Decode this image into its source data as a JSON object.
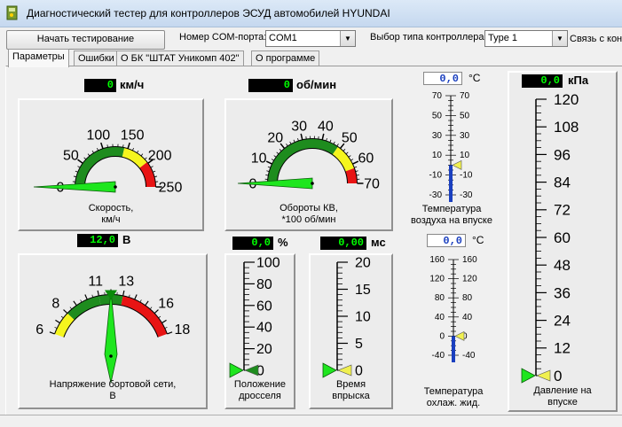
{
  "window": {
    "title": "Диагностический тестер для контроллеров ЭСУД автомобилей HYUNDAI"
  },
  "toolbar": {
    "start_label": "Начать тестирование",
    "com_label": "Номер COM-порта:",
    "com_value": "COM1",
    "ctrl_label": "Выбор типа контроллера",
    "ctrl_value": "Type 1",
    "link_label": "Связь с кон"
  },
  "tabs": [
    {
      "label": "Параметры",
      "active": true
    },
    {
      "label": "Ошибки",
      "active": false
    },
    {
      "label": "О БК \"ШТАТ Уникомп 402\"",
      "active": false
    },
    {
      "label": "О программе",
      "active": false
    }
  ],
  "colors": {
    "green": "#1e8c1e",
    "yellow": "#f5f51e",
    "red": "#e81414",
    "needle": "#1ee61e",
    "blue_bar": "#1a3fbf"
  },
  "gauges": {
    "speed": {
      "display": "0",
      "unit": "км/ч",
      "caption1": "Скорость,",
      "caption2": "км/ч",
      "value": 0,
      "ticks": [
        "0",
        "50",
        "100",
        "150",
        "200",
        "250"
      ]
    },
    "rpm": {
      "display": "0",
      "unit": "об/мин",
      "caption1": "Обороты КВ,",
      "caption2": "*100 об/мин",
      "value": 0,
      "ticks": [
        "0",
        "10",
        "20",
        "30",
        "40",
        "50",
        "60",
        "70"
      ]
    },
    "voltage": {
      "display": "12,0",
      "unit": "В",
      "caption1": "Напряжение бортовой сети,",
      "caption2": "В",
      "value": 12.0,
      "ticks": [
        "6",
        "8",
        "11",
        "13",
        "16",
        "18"
      ]
    }
  },
  "bars": {
    "throttle": {
      "display": "0,0",
      "unit": "%",
      "caption1": "Положение",
      "caption2": "дросселя",
      "value": 0,
      "ticks": [
        "100",
        "80",
        "60",
        "40",
        "20",
        "0"
      ]
    },
    "injection": {
      "display": "0,00",
      "unit": "мс",
      "caption1": "Время",
      "caption2": "впрыска",
      "value": 0,
      "ticks": [
        "20",
        "15",
        "10",
        "5",
        "0"
      ]
    },
    "pressure": {
      "display": "0,0",
      "unit": "кПа",
      "caption1": "Давление на",
      "caption2": "впуске",
      "value": 0,
      "ticks": [
        "120",
        "108",
        "96",
        "84",
        "72",
        "60",
        "48",
        "36",
        "24",
        "12",
        "0"
      ]
    }
  },
  "thermo": {
    "air": {
      "display": "0,0",
      "unit": "°C",
      "caption1": "Температура",
      "caption2": "воздуха на впуске",
      "value": 0,
      "ticks": [
        "70",
        "50",
        "30",
        "10",
        "-10",
        "-30"
      ]
    },
    "coolant": {
      "display": "0,0",
      "unit": "°C",
      "caption1": "Температура",
      "caption2": "охлаж. жид.",
      "value": 0,
      "ticks": [
        "160",
        "120",
        "80",
        "40",
        "0",
        "-40"
      ]
    }
  }
}
